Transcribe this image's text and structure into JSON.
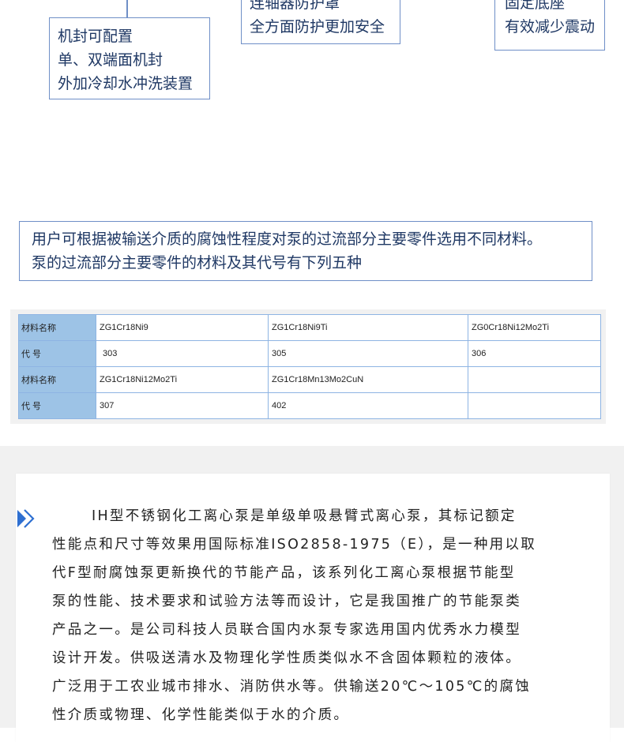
{
  "callouts": {
    "seal": [
      "机封可配置",
      "单、双端面机封",
      "外加冷却水冲洗装置"
    ],
    "guard": [
      "连轴器防护罩",
      "全方面防护更加安全"
    ],
    "base": [
      "固定底座",
      "有效减少震动"
    ]
  },
  "notice": [
    "用户可根据被输送介质的腐蚀性程度对泵的过流部分主要零件选用不同材料。",
    "泵的过流部分主要零件的材料及其代号有下列五种"
  ],
  "materials_table": {
    "rows": [
      [
        "材料名称",
        "ZG1Cr18Ni9",
        "ZG1Cr18Ni9Ti",
        "ZG0Cr18Ni12Mo2Ti"
      ],
      [
        "代 号",
        " 303",
        "305",
        "306"
      ],
      [
        "材料名称",
        "ZG1Cr18Ni12Mo2Ti",
        "ZG1Cr18Mn13Mo2CuN",
        ""
      ],
      [
        "代 号",
        "307",
        "402",
        ""
      ]
    ]
  },
  "description": {
    "arrow_icon": "double-chevron-right-icon",
    "lines": [
      "IH型不锈钢化工离心泵是单级单吸悬臂式离心泵，其标记额定",
      "性能点和尺寸等效果用国际标准ISO2858-1975（E），是一种用以取",
      "代F型耐腐蚀泵更新换代的节能产品，该系列化工离心泵根据节能型",
      "泵的性能、技术要求和试验方法等而设计，它是我国推广的节能泵类",
      "产品之一。是公司科技人员联合国内水泵专家选用国内优秀水力模型",
      "设计开发。供吸送清水及物理化学性质类似水不含固体颗粒的液体。",
      "广泛用于工农业城市排水、消防供水等。供输送20℃～105℃的腐蚀",
      "性介质或物理、化学性能类似于水的介质。"
    ]
  },
  "colors": {
    "accent": "#6f8fc7",
    "text": "#1f3864",
    "table_head": "#9dc3e6",
    "arrow": "#2e6fd1"
  }
}
